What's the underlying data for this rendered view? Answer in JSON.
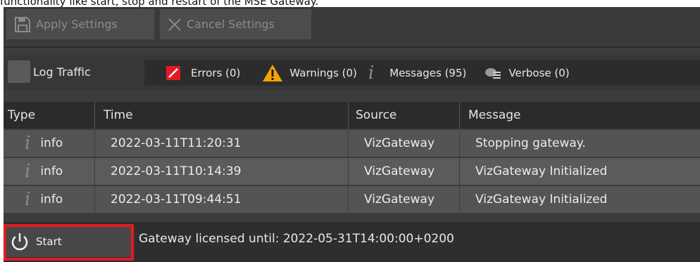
{
  "caption": "functionality like start, stop and restart of the MSE Gateway.",
  "toolbar": {
    "apply_label": "Apply Settings",
    "cancel_label": "Cancel Settings"
  },
  "filter": {
    "log_traffic_label": "Log Traffic",
    "errors_label": "Errors (0)",
    "warnings_label": "Warnings (0)",
    "messages_label": "Messages (95)",
    "verbose_label": "Verbose (0)"
  },
  "table": {
    "headers": [
      "Type",
      "Time",
      "Source",
      "Message"
    ],
    "rows": [
      {
        "type": "info",
        "time": "2022-03-11T11:20:31",
        "source": "VizGateway",
        "message": "Stopping gateway."
      },
      {
        "type": "info",
        "time": "2022-03-11T10:14:39",
        "source": "VizGateway",
        "message": "VizGateway Initialized"
      },
      {
        "type": "info",
        "time": "2022-03-11T09:44:51",
        "source": "VizGateway",
        "message": "VizGateway Initialized"
      }
    ]
  },
  "status": {
    "start_label": "Start",
    "license_text": "Gateway licensed until: 2022-05-31T14:00:00+0200"
  },
  "colors": {
    "highlight": "#e11b22",
    "error_icon": "#e11b22",
    "warning_icon": "#f5a300"
  }
}
